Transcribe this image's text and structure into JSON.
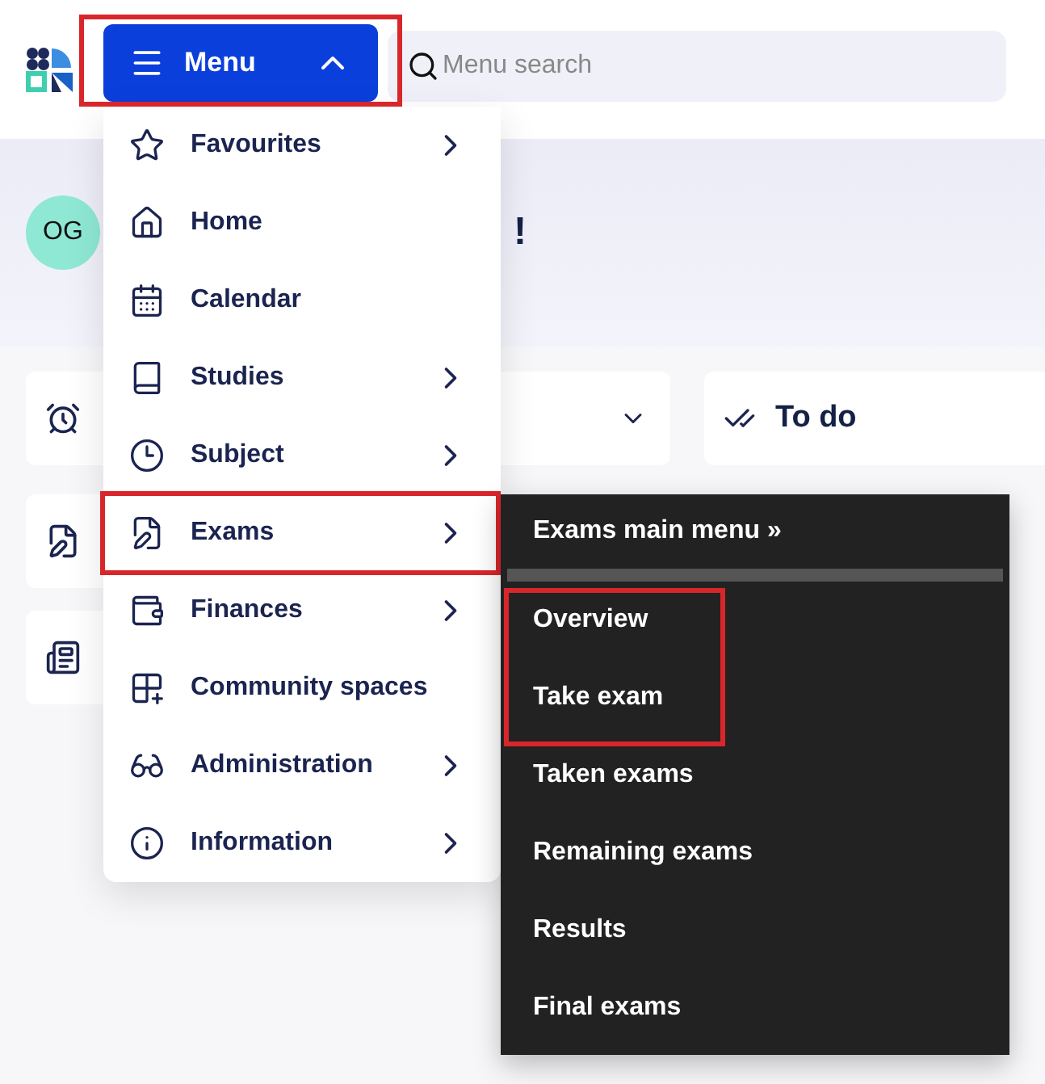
{
  "header": {
    "menu_button": {
      "label": "Menu",
      "expanded": true,
      "highlighted": true
    },
    "search": {
      "placeholder": "Menu search"
    }
  },
  "dashboard": {
    "avatar": "OG",
    "greeting_tail": "!",
    "todo_title": "To do"
  },
  "menu": {
    "items": [
      {
        "label": "Favourites",
        "has_submenu": true,
        "highlighted": false
      },
      {
        "label": "Home",
        "has_submenu": false,
        "highlighted": false
      },
      {
        "label": "Calendar",
        "has_submenu": false,
        "highlighted": false
      },
      {
        "label": "Studies",
        "has_submenu": true,
        "highlighted": false
      },
      {
        "label": "Subject",
        "has_submenu": true,
        "highlighted": false
      },
      {
        "label": "Exams",
        "has_submenu": true,
        "highlighted": true
      },
      {
        "label": "Finances",
        "has_submenu": true,
        "highlighted": false
      },
      {
        "label": "Community spaces",
        "has_submenu": false,
        "highlighted": false
      },
      {
        "label": "Administration",
        "has_submenu": true,
        "highlighted": false
      },
      {
        "label": "Information",
        "has_submenu": true,
        "highlighted": false
      }
    ]
  },
  "submenu": {
    "title": "Exams main menu »",
    "items": [
      {
        "label": "Overview",
        "highlighted": true
      },
      {
        "label": "Take exam",
        "highlighted": true
      },
      {
        "label": "Taken exams",
        "highlighted": false
      },
      {
        "label": "Remaining exams",
        "highlighted": false
      },
      {
        "label": "Results",
        "highlighted": false
      },
      {
        "label": "Final exams",
        "highlighted": false
      }
    ]
  }
}
